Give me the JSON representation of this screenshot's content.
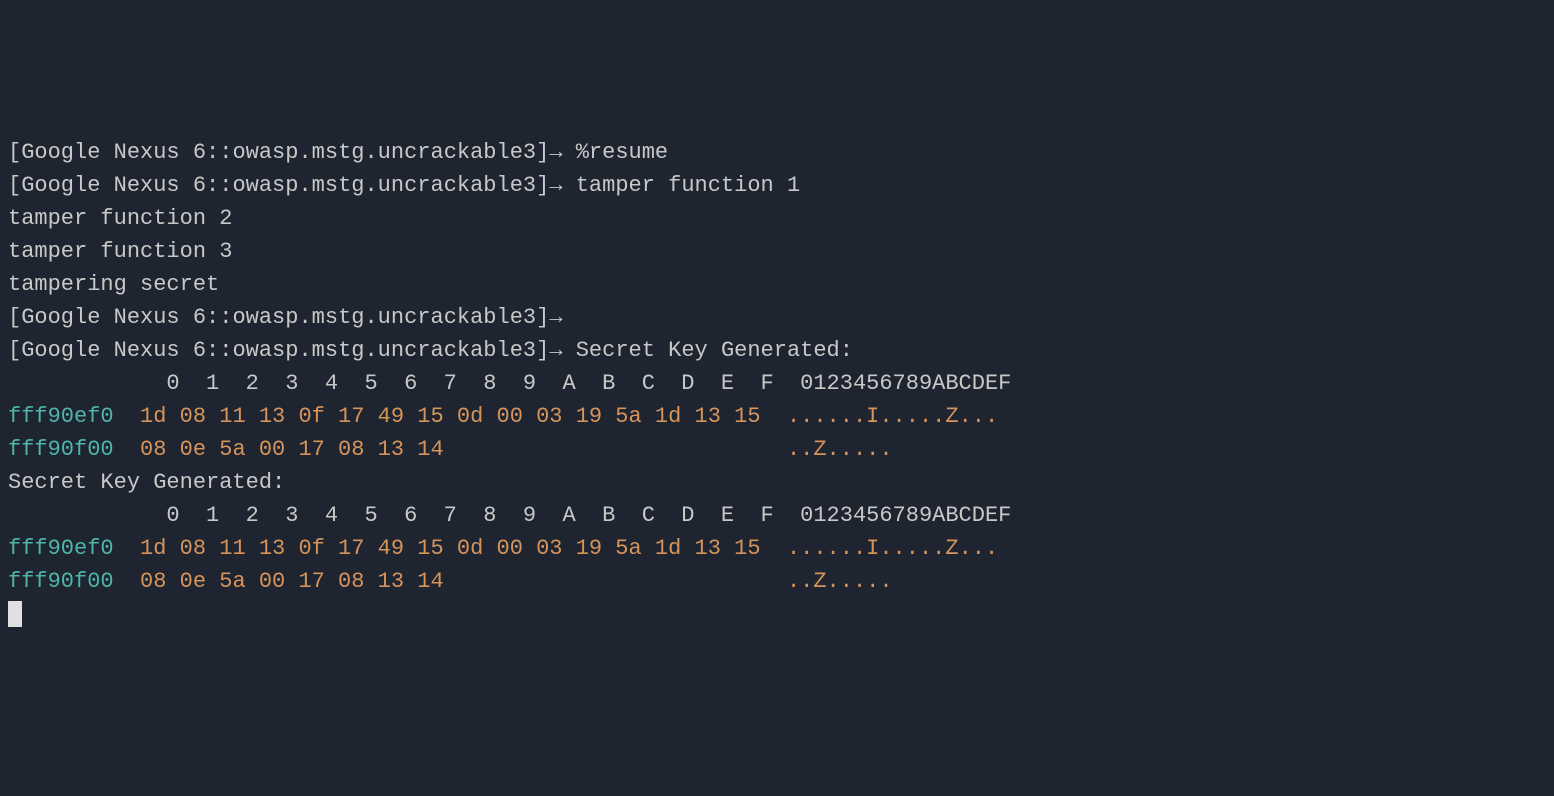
{
  "lines": [
    {
      "type": "prompt",
      "device": "[Google Nexus 6",
      "sep": "::",
      "pkg": "owasp.mstg.uncrackable3]",
      "arrow": "→ ",
      "text": "%resume"
    },
    {
      "type": "prompt",
      "device": "[Google Nexus 6",
      "sep": "::",
      "pkg": "owasp.mstg.uncrackable3]",
      "arrow": "→ ",
      "text": "tamper function 1"
    },
    {
      "type": "plain",
      "text": "tamper function 2"
    },
    {
      "type": "plain",
      "text": "tamper function 3"
    },
    {
      "type": "plain",
      "text": "tampering secret"
    },
    {
      "type": "prompt",
      "device": "[Google Nexus 6",
      "sep": "::",
      "pkg": "owasp.mstg.uncrackable3]",
      "arrow": "→",
      "text": ""
    },
    {
      "type": "prompt",
      "device": "[Google Nexus 6",
      "sep": "::",
      "pkg": "owasp.mstg.uncrackable3]",
      "arrow": "→ ",
      "text": "Secret Key Generated:"
    },
    {
      "type": "header",
      "text": "            0  1  2  3  4  5  6  7  8  9  A  B  C  D  E  F  0123456789ABCDEF"
    },
    {
      "type": "hexrow",
      "addr": "fff90ef0",
      "hex": "  1d 08 11 13 0f 17 49 15 0d 00 03 19 5a 1d 13 15  ",
      "ascii": "......I.....Z..."
    },
    {
      "type": "hexrow",
      "addr": "fff90f00",
      "hex": "  08 0e 5a 00 17 08 13 14                          ",
      "ascii": "..Z....."
    },
    {
      "type": "plain",
      "text": "Secret Key Generated:"
    },
    {
      "type": "header",
      "text": "            0  1  2  3  4  5  6  7  8  9  A  B  C  D  E  F  0123456789ABCDEF"
    },
    {
      "type": "hexrow",
      "addr": "fff90ef0",
      "hex": "  1d 08 11 13 0f 17 49 15 0d 00 03 19 5a 1d 13 15  ",
      "ascii": "......I.....Z..."
    },
    {
      "type": "hexrow",
      "addr": "fff90f00",
      "hex": "  08 0e 5a 00 17 08 13 14                          ",
      "ascii": "..Z....."
    }
  ]
}
